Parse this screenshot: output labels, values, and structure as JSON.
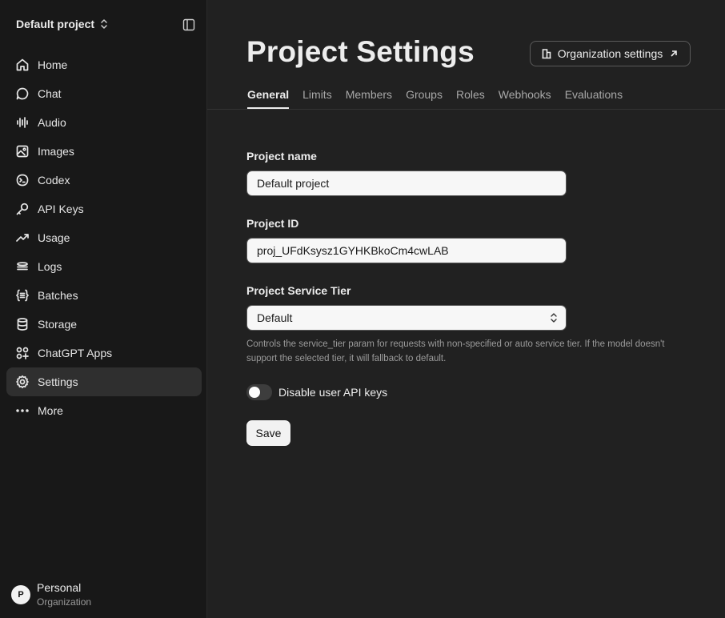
{
  "sidebar": {
    "project_name": "Default project",
    "items": [
      {
        "label": "Home",
        "icon": "home-icon"
      },
      {
        "label": "Chat",
        "icon": "chat-icon"
      },
      {
        "label": "Audio",
        "icon": "audio-icon"
      },
      {
        "label": "Images",
        "icon": "image-icon"
      },
      {
        "label": "Codex",
        "icon": "codex-icon"
      },
      {
        "label": "API Keys",
        "icon": "key-icon"
      },
      {
        "label": "Usage",
        "icon": "trend-icon"
      },
      {
        "label": "Logs",
        "icon": "logs-icon"
      },
      {
        "label": "Batches",
        "icon": "batches-icon"
      },
      {
        "label": "Storage",
        "icon": "database-icon"
      },
      {
        "label": "ChatGPT Apps",
        "icon": "apps-icon"
      },
      {
        "label": "Settings",
        "icon": "gear-icon",
        "active": true
      },
      {
        "label": "More",
        "icon": "more-icon"
      }
    ],
    "org": {
      "avatar_letter": "P",
      "name": "Personal",
      "subtitle": "Organization"
    }
  },
  "header": {
    "title": "Project Settings",
    "org_button": "Organization settings"
  },
  "tabs": [
    "General",
    "Limits",
    "Members",
    "Groups",
    "Roles",
    "Webhooks",
    "Evaluations"
  ],
  "form": {
    "project_name_label": "Project name",
    "project_name_value": "Default project",
    "project_id_label": "Project ID",
    "project_id_value": "proj_UFdKsysz1GYHKBkoCm4cwLAB",
    "service_tier_label": "Project Service Tier",
    "service_tier_value": "Default",
    "help_text": "Controls the service_tier param for requests with non-specified or auto service tier. If the model doesn't support the selected tier, it will fallback to default.",
    "toggle_label": "Disable user API keys",
    "toggle_on": false,
    "save_label": "Save"
  },
  "colors": {
    "sidebar_bg": "#181818",
    "main_bg": "#212121",
    "active_item_bg": "#2f2f2f",
    "input_bg": "#f7f7f7"
  }
}
